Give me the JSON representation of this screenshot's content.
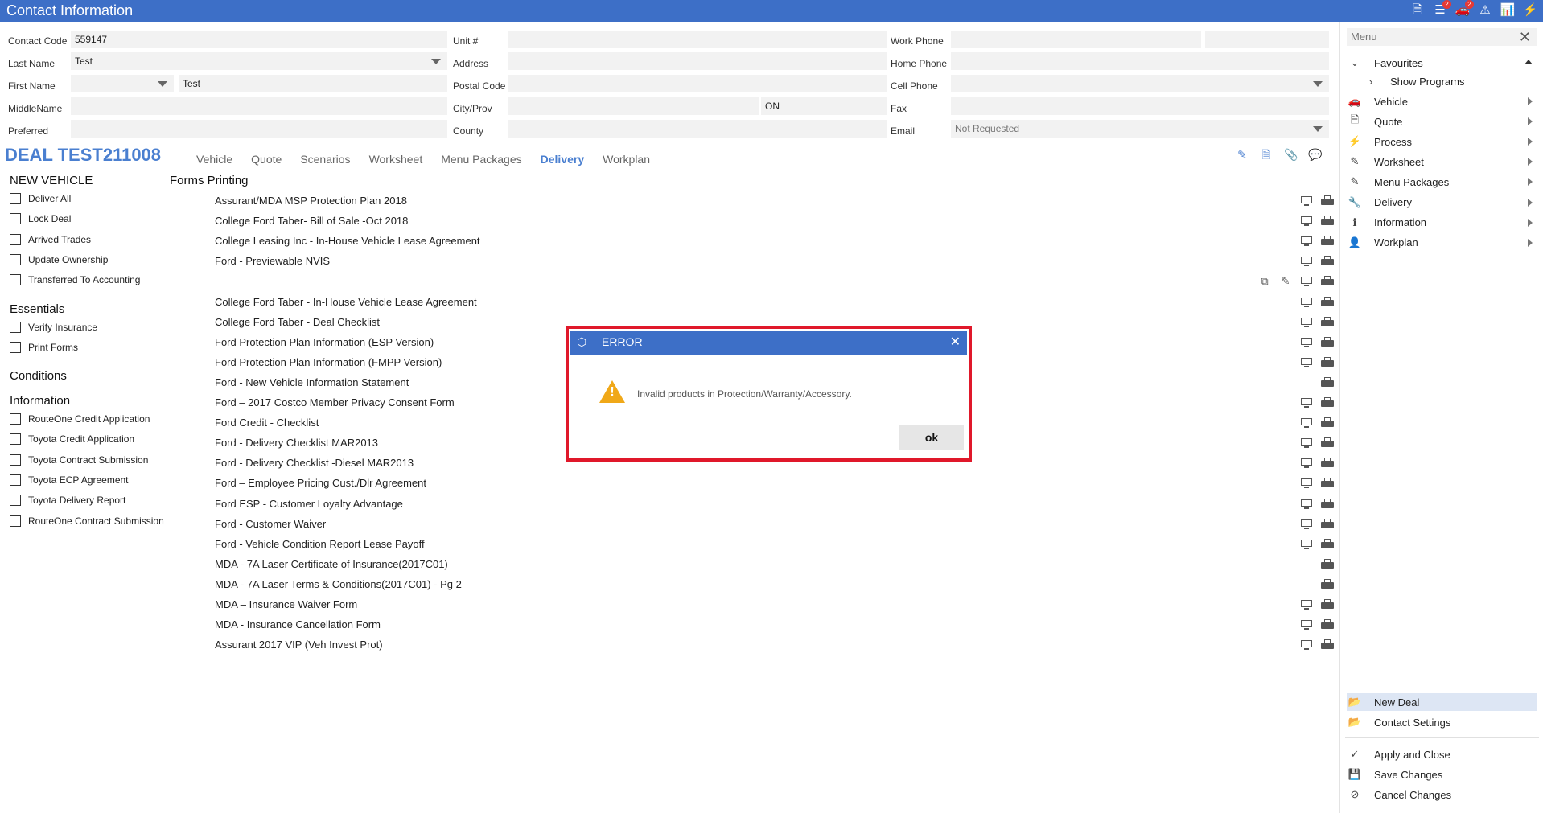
{
  "window": {
    "title": "Contact Information"
  },
  "toolbar_icons": [
    {
      "name": "document-icon",
      "glyph": "🗎",
      "badge": ""
    },
    {
      "name": "list-icon",
      "glyph": "☰",
      "badge": "2"
    },
    {
      "name": "car-icon",
      "glyph": "🚗",
      "badge": "2"
    },
    {
      "name": "warning-icon",
      "glyph": "⚠",
      "badge": ""
    },
    {
      "name": "chart-icon",
      "glyph": "📊",
      "badge": ""
    },
    {
      "name": "process-icon",
      "glyph": "⚡",
      "badge": ""
    }
  ],
  "contact": {
    "contact_code_label": "Contact Code",
    "contact_code": "559147",
    "last_name_label": "Last Name",
    "last_name": "Test",
    "first_name_label": "First Name",
    "first_name": "Test",
    "middle_name_label": "MiddleName",
    "middle_name": "",
    "preferred_label": "Preferred",
    "preferred": "",
    "unit_label": "Unit #",
    "unit": "",
    "address_label": "Address",
    "address": "",
    "postal_label": "Postal Code",
    "postal": "",
    "city_label": "City/Prov",
    "city": "",
    "prov": "ON",
    "county_label": "County",
    "county": "",
    "work_phone_label": "Work Phone",
    "work_phone": "",
    "home_phone_label": "Home Phone",
    "home_phone": "",
    "cell_phone_label": "Cell Phone",
    "cell_phone": "",
    "fax_label": "Fax",
    "fax": "",
    "email_label": "Email",
    "email": "Not Requested"
  },
  "deal": {
    "title": "DEAL TEST211008",
    "tabs": [
      "Vehicle",
      "Quote",
      "Scenarios",
      "Worksheet",
      "Menu Packages",
      "Delivery",
      "Workplan"
    ],
    "active_tab": "Delivery"
  },
  "left": {
    "new_vehicle_title": "NEW VEHICLE",
    "new_vehicle_items": [
      "Deliver All",
      "Lock Deal",
      "Arrived Trades",
      "Update Ownership",
      "Transferred To Accounting"
    ],
    "essentials_title": "Essentials",
    "essentials_items": [
      "Verify Insurance",
      "Print Forms"
    ],
    "conditions_title": "Conditions",
    "information_title": "Information",
    "information_items": [
      "RouteOne Credit Application",
      "Toyota Credit Application",
      "Toyota Contract Submission",
      "Toyota ECP Agreement",
      "Toyota Delivery Report",
      "RouteOne Contract Submission"
    ]
  },
  "forms": {
    "title": "Forms Printing",
    "rows": [
      "Assurant/MDA MSP Protection Plan 2018",
      "College Ford Taber- Bill of Sale -Oct 2018",
      "College Leasing Inc - In-House Vehicle Lease Agreement",
      "Ford - Previewable NVIS",
      "",
      "College Ford Taber - In-House Vehicle Lease Agreement",
      "College Ford Taber - Deal Checklist",
      "Ford Protection Plan Information (ESP Version)",
      "Ford Protection Plan Information (FMPP Version)",
      "Ford - New Vehicle Information Statement",
      "Ford – 2017 Costco Member Privacy Consent Form",
      "Ford Credit - Checklist",
      "Ford -  Delivery Checklist MAR2013",
      "Ford - Delivery Checklist -Diesel MAR2013",
      "Ford – Employee Pricing Cust./Dlr Agreement",
      "Ford ESP - Customer Loyalty Advantage",
      "Ford - Customer Waiver",
      "Ford - Vehicle Condition Report Lease Payoff",
      "MDA - 7A Laser Certificate of Insurance(2017C01)",
      "MDA - 7A Laser Terms & Conditions(2017C01) - Pg 2",
      "MDA – Insurance Waiver Form",
      "MDA - Insurance Cancellation Form",
      "Assurant 2017 VIP (Veh Invest Prot)"
    ]
  },
  "menu": {
    "search_placeholder": "Menu",
    "favourites": "Favourites",
    "show_programs": "Show Programs",
    "items": [
      {
        "label": "Vehicle",
        "icon": "car-icon",
        "glyph": "🚗"
      },
      {
        "label": "Quote",
        "icon": "quote-icon",
        "glyph": "🗎"
      },
      {
        "label": "Process",
        "icon": "process-icon",
        "glyph": "⚡"
      },
      {
        "label": "Worksheet",
        "icon": "pencil-icon",
        "glyph": "✎"
      },
      {
        "label": "Menu Packages",
        "icon": "pencil-icon",
        "glyph": "✎"
      },
      {
        "label": "Delivery",
        "icon": "wrench-icon",
        "glyph": "🔧"
      },
      {
        "label": "Information",
        "icon": "info-icon",
        "glyph": "ℹ"
      },
      {
        "label": "Workplan",
        "icon": "person-icon",
        "glyph": "👤"
      }
    ],
    "bottom_items": [
      {
        "label": "New Deal",
        "icon": "folder-icon",
        "glyph": "📂"
      },
      {
        "label": "Contact Settings",
        "icon": "folder-icon",
        "glyph": "📂"
      }
    ],
    "action_items": [
      {
        "label": "Apply and Close",
        "icon": "check-icon",
        "glyph": "✓"
      },
      {
        "label": "Save Changes",
        "icon": "save-icon",
        "glyph": "💾"
      },
      {
        "label": "Cancel Changes",
        "icon": "cancel-icon",
        "glyph": "⊘"
      }
    ]
  },
  "modal": {
    "title": "ERROR",
    "message": "Invalid products in Protection/Warranty/Accessory.",
    "ok_label": "ok"
  },
  "colors": {
    "accent": "#3d6fc7",
    "deal_blue": "#4a7fd0",
    "error_border": "#e0182a",
    "warning": "#f0a818"
  }
}
